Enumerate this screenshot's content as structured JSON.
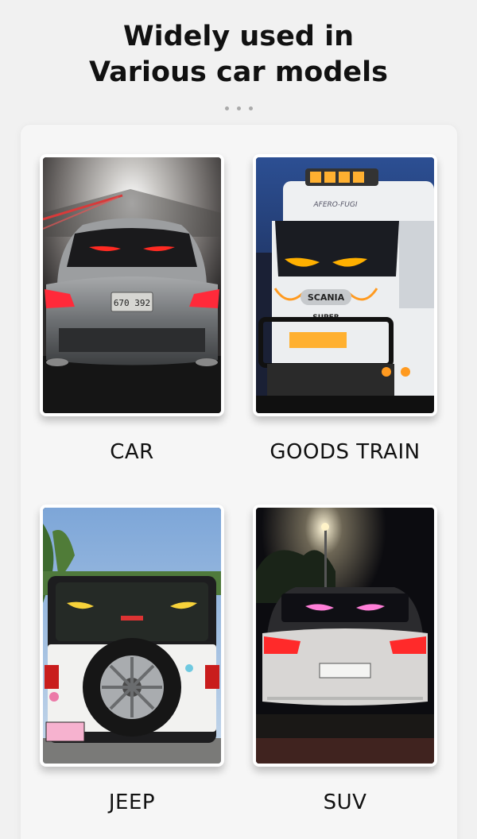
{
  "headline": {
    "line1": "Widely used in",
    "line2": "Various car models"
  },
  "cards": [
    {
      "label": "CAR",
      "plate": "670 392"
    },
    {
      "label": "GOODS TRAIN",
      "cab_text": "AFERO-FUGI",
      "brand": "SCANIA",
      "badge": "SUPER"
    },
    {
      "label": "JEEP"
    },
    {
      "label": "SUV"
    }
  ],
  "colors": {
    "page_background": "#f1f1f1",
    "panel_background": "#f6f6f6",
    "text": "#111111"
  }
}
